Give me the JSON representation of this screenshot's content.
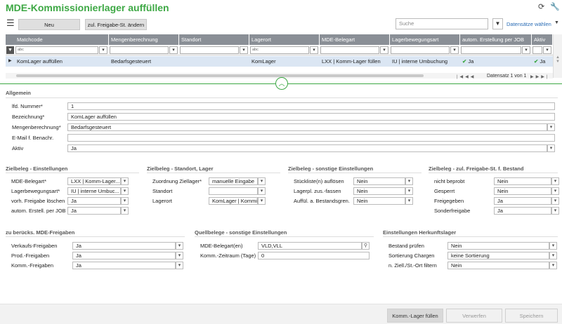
{
  "header": {
    "title": "MDE-Kommissionierlager auffüllen"
  },
  "toolbar": {
    "new_label": "Neu",
    "change_label": "zul. Freigabe-St. ändern",
    "search_placeholder": "Suche",
    "datasets_label": "Datensätze wählen"
  },
  "grid": {
    "columns": [
      "Matchcode",
      "Mengenberechnung",
      "Standort",
      "Lagerort",
      "MDE-Belegart",
      "Lagerbewegungsart",
      "autom. Erstellung per JOB",
      "Aktiv"
    ],
    "filter_abc": "abc",
    "row": {
      "matchcode": "KomLager auffüllen",
      "mengenberechnung": "Bedarfsgesteuert",
      "standort": "",
      "lagerort": "KomLager",
      "belegart": "LXX | Komm-Lager füllen",
      "lagerbewegungsart": "IU | interne Umbuchung",
      "job": "Ja",
      "aktiv": "Ja"
    },
    "status": "Datensatz 1 von 1"
  },
  "allgemein": {
    "title": "Allgemein",
    "fields": [
      {
        "label": "lfd. Nummer*",
        "value": "1",
        "dropdown": false
      },
      {
        "label": "Bezeichnung*",
        "value": "KomLager auffüllen",
        "dropdown": false
      },
      {
        "label": "Mengenberechnung*",
        "value": "Bedarfsgesteuert",
        "dropdown": true
      },
      {
        "label": "E-Mail f. Benachr.",
        "value": "",
        "dropdown": false
      },
      {
        "label": "Aktiv",
        "value": "Ja",
        "dropdown": true
      }
    ]
  },
  "sections1": [
    {
      "title": "Zielbeleg - Einstellungen",
      "fields": [
        {
          "label": "MDE-Belegart*",
          "value": "LXX | Komm-Lager..."
        },
        {
          "label": "Lagerbewegungsart*",
          "value": "IU | interne Umbuc..."
        },
        {
          "label": "vorh. Freigabe löschen",
          "value": "Ja"
        },
        {
          "label": "autom. Erstell. per JOB",
          "value": "Ja"
        }
      ]
    },
    {
      "title": "Zielbeleg - Standort, Lager",
      "fields": [
        {
          "label": "Zuordnung Ziellager*",
          "value": "manuelle Eingabe"
        },
        {
          "label": "Standort",
          "value": ""
        },
        {
          "label": "Lagerort",
          "value": "KomLager | Kommi..."
        }
      ]
    },
    {
      "title": "Zielbeleg - sonstige Einstellungen",
      "fields": [
        {
          "label": "Stückliste(n) auflösen",
          "value": "Nein"
        },
        {
          "label": "Lagerpl. zus.-fassen",
          "value": "Nein"
        },
        {
          "label": "Auffül. a. Bestandsgren.",
          "value": "Nein"
        }
      ]
    },
    {
      "title": "Zielbeleg - zul. Freigabe-St. f. Bestand",
      "fields": [
        {
          "label": "nicht beprobt",
          "value": "Nein"
        },
        {
          "label": "Gesperrt",
          "value": "Nein"
        },
        {
          "label": "Freigegeben",
          "value": "Ja"
        },
        {
          "label": "Sonderfreigabe",
          "value": "Ja"
        }
      ]
    }
  ],
  "sections2": [
    {
      "title": "zu berücks. MDE-Freigaben",
      "fields": [
        {
          "label": "Verkaufs-Freigaben",
          "value": "Ja"
        },
        {
          "label": "Prod.-Freigaben",
          "value": "Ja"
        },
        {
          "label": "Komm.-Freigaben",
          "value": "Ja"
        }
      ]
    },
    {
      "title": "Quellbelege - sonstige Einstellungen",
      "fields": [
        {
          "label": "MDE-Belegart(en)",
          "value": "VLD,VLL"
        },
        {
          "label": "Komm.-Zeitraum (Tage)",
          "value": "0"
        }
      ]
    },
    {
      "title": "Einstellungen Herkunftslager",
      "fields": [
        {
          "label": "Bestand prüfen",
          "value": "Nein"
        },
        {
          "label": "Sortierung Chargen",
          "value": "keine Sortierung"
        },
        {
          "label": "n. Ziell./St.-Ort filtern",
          "value": "Nein"
        }
      ]
    }
  ],
  "footer": {
    "fill_label": "Komm.-Lager füllen",
    "discard_label": "Verwerfen",
    "save_label": "Speichern"
  },
  "colors": {
    "brand": "#3da844",
    "header": "#8a8f96",
    "selected_row": "#dbe6f3"
  }
}
